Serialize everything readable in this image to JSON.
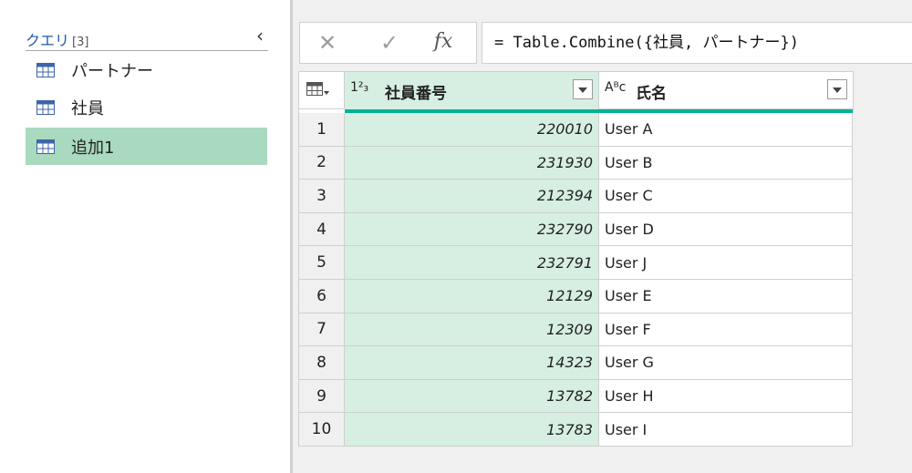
{
  "queries": {
    "title": "クエリ",
    "count": "[3]",
    "collapse_glyph": "‹",
    "items": [
      {
        "label": "パートナー",
        "selected": false
      },
      {
        "label": "社員",
        "selected": false
      },
      {
        "label": "追加1",
        "selected": true
      }
    ]
  },
  "formula_bar": {
    "cancel_glyph": "✕",
    "confirm_glyph": "✓",
    "fx_label": "fx",
    "formula": "= Table.Combine({社員, パートナー})"
  },
  "grid": {
    "columns": [
      {
        "type_icon": "1²₃",
        "title": "社員番号"
      },
      {
        "type_icon": "Aᴮc",
        "title": "氏名"
      }
    ],
    "rows": [
      {
        "index": "1",
        "id": "220010",
        "name": "User A"
      },
      {
        "index": "2",
        "id": "231930",
        "name": "User B"
      },
      {
        "index": "3",
        "id": "212394",
        "name": "User C"
      },
      {
        "index": "4",
        "id": "232790",
        "name": "User D"
      },
      {
        "index": "5",
        "id": "232791",
        "name": "User J"
      },
      {
        "index": "6",
        "id": "12129",
        "name": "User E"
      },
      {
        "index": "7",
        "id": "12309",
        "name": "User F"
      },
      {
        "index": "8",
        "id": "14323",
        "name": "User G"
      },
      {
        "index": "9",
        "id": "13782",
        "name": "User H"
      },
      {
        "index": "10",
        "id": "13783",
        "name": "User I"
      }
    ]
  },
  "colors": {
    "selected_query": "#a9d9be",
    "selected_column": "#d6efe2",
    "quality_bar": "#00b294",
    "query_title": "#1e5aa8"
  }
}
